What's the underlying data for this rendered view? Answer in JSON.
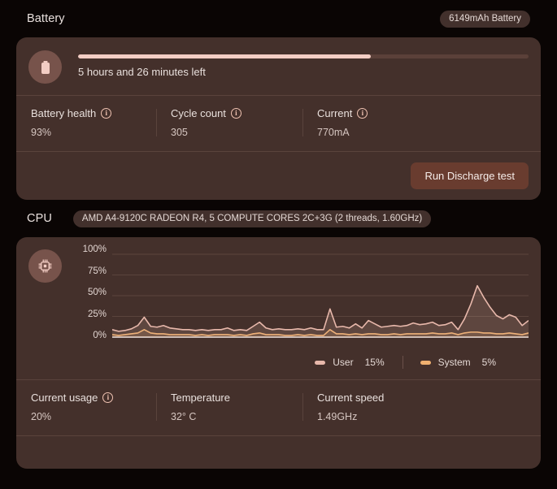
{
  "theme": {
    "page_bg": "#0a0504",
    "card_bg": "#44302b",
    "accent": "#f3cdc4",
    "user_line": "#e8b8ab",
    "system_line": "#f0b070",
    "button_bg": "#693c2f"
  },
  "battery": {
    "title": "Battery",
    "badge": "6149mAh Battery",
    "icon": "battery-icon",
    "info_glyph": "i",
    "time_remaining": "5 hours and 26 minutes left",
    "charge_percent": 65,
    "stats": [
      {
        "label": "Battery health",
        "value": "93%",
        "has_info": true
      },
      {
        "label": "Cycle count",
        "value": "305",
        "has_info": true
      },
      {
        "label": "Current",
        "value": "770mA",
        "has_info": true
      }
    ],
    "action_button": "Run Discharge test"
  },
  "cpu": {
    "title": "CPU",
    "badge": "AMD A4-9120C RADEON R4, 5 COMPUTE CORES 2C+3G (2 threads, 1.60GHz)",
    "icon": "cpu-chip-icon",
    "legend": [
      {
        "name": "User",
        "value": "15%",
        "color": "#e8b8ab"
      },
      {
        "name": "System",
        "value": "5%",
        "color": "#f0b070"
      }
    ],
    "stats": [
      {
        "label": "Current usage",
        "value": "20%",
        "has_info": true
      },
      {
        "label": "Temperature",
        "value": "32° C",
        "has_info": false
      },
      {
        "label": "Current speed",
        "value": "1.49GHz",
        "has_info": false
      }
    ]
  },
  "chart_data": {
    "type": "line",
    "title": "CPU usage over time",
    "xlabel": "",
    "ylabel": "",
    "ylim": [
      0,
      100
    ],
    "yticks": [
      "100%",
      "75%",
      "50%",
      "25%",
      "0%"
    ],
    "ytick_values": [
      100,
      75,
      50,
      25,
      0
    ],
    "grid": true,
    "legend_position": "bottom-right",
    "x": [
      0,
      1,
      2,
      3,
      4,
      5,
      6,
      7,
      8,
      9,
      10,
      11,
      12,
      13,
      14,
      15,
      16,
      17,
      18,
      19,
      20,
      21,
      22,
      23,
      24,
      25,
      26,
      27,
      28,
      29,
      30,
      31,
      32,
      33,
      34,
      35,
      36,
      37,
      38,
      39,
      40,
      41,
      42,
      43,
      44,
      45,
      46,
      47,
      48,
      49
    ],
    "series": [
      {
        "name": "User",
        "color": "#e8b8ab",
        "values": [
          9,
          7,
          8,
          10,
          14,
          24,
          13,
          12,
          14,
          11,
          10,
          9,
          9,
          8,
          9,
          8,
          9,
          9,
          11,
          8,
          9,
          8,
          13,
          18,
          11,
          9,
          10,
          9,
          9,
          10,
          9,
          11,
          9,
          9,
          34,
          12,
          13,
          11,
          16,
          11,
          20,
          16,
          12,
          13,
          14,
          13,
          14,
          17,
          15,
          16,
          18,
          14,
          15,
          18,
          9,
          22,
          40,
          62,
          48,
          36,
          26,
          22,
          27,
          24,
          14,
          20
        ]
      },
      {
        "name": "System",
        "color": "#f0b070",
        "values": [
          3,
          2,
          3,
          4,
          5,
          9,
          5,
          4,
          4,
          3,
          3,
          3,
          3,
          2,
          3,
          2,
          3,
          3,
          3,
          2,
          3,
          2,
          4,
          5,
          3,
          3,
          3,
          2,
          2,
          3,
          2,
          3,
          2,
          2,
          9,
          4,
          4,
          3,
          4,
          3,
          4,
          4,
          3,
          3,
          4,
          3,
          4,
          4,
          4,
          4,
          5,
          4,
          4,
          5,
          3,
          5,
          6,
          6,
          5,
          5,
          4,
          4,
          5,
          4,
          3,
          5
        ]
      }
    ]
  }
}
